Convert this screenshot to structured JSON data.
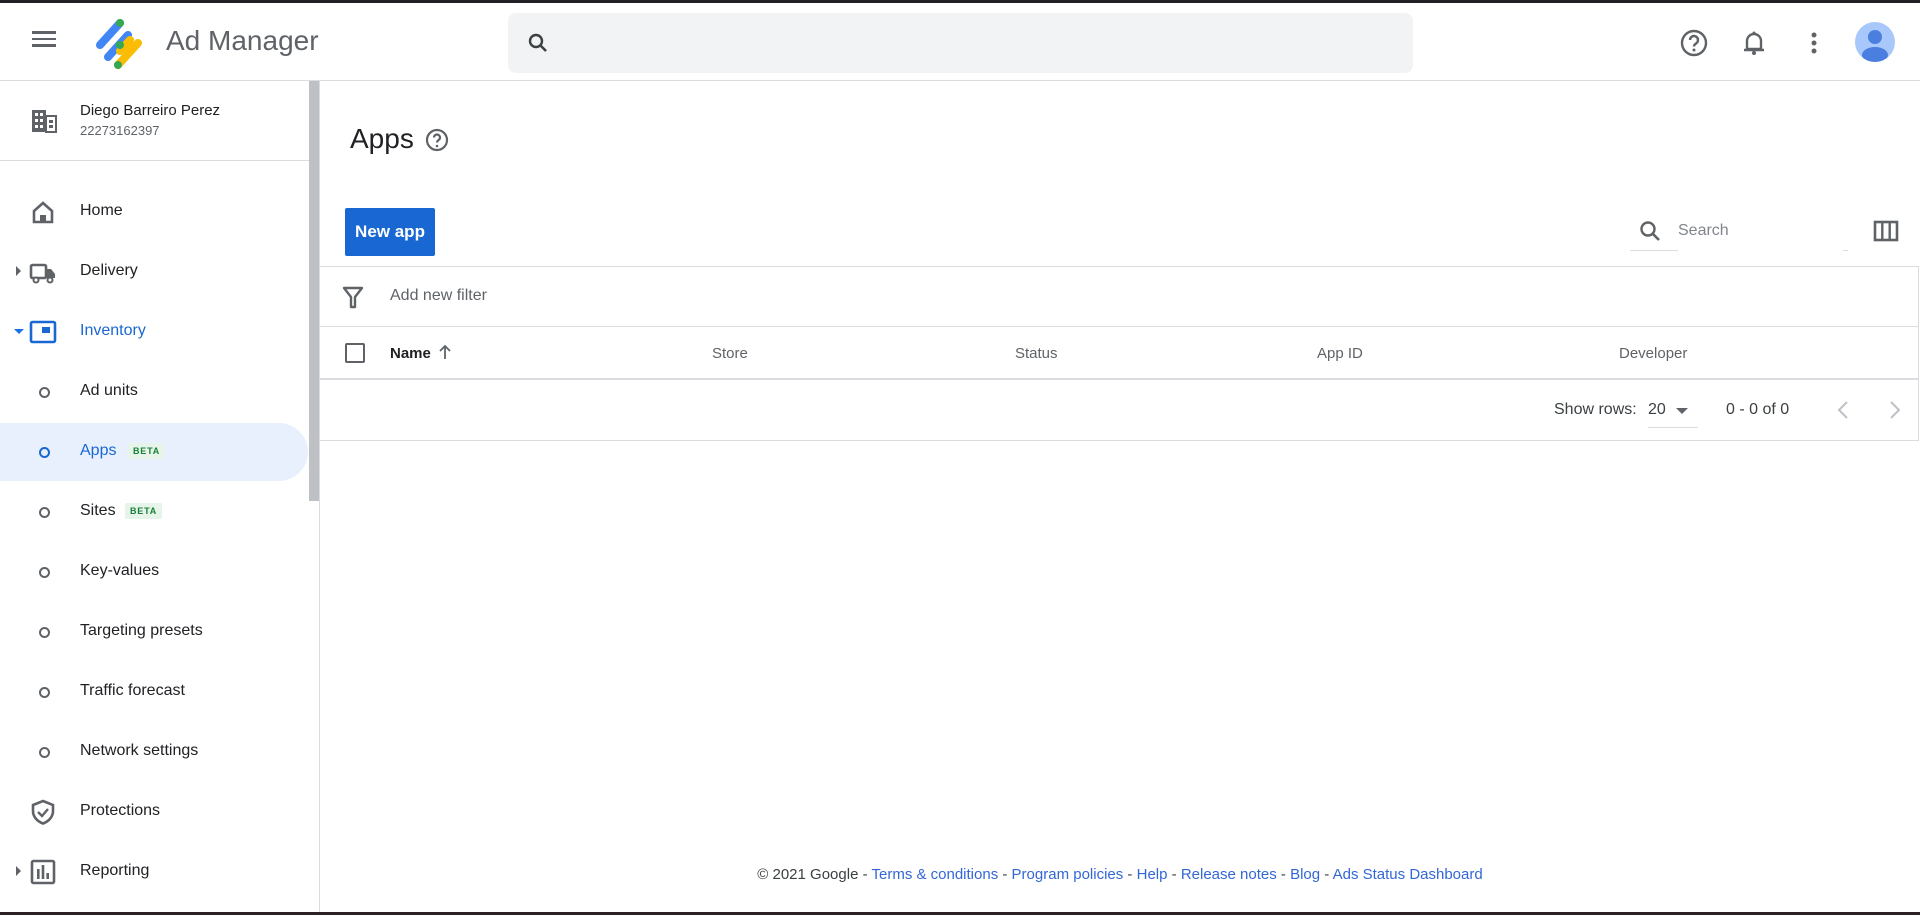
{
  "header": {
    "app_name": "Ad Manager",
    "search_placeholder": "",
    "icons": [
      "menu-icon",
      "search-icon",
      "help-icon",
      "notifications-icon",
      "more-vert-icon",
      "account-avatar"
    ]
  },
  "account": {
    "name": "Diego Barreiro Perez",
    "id": "22273162397"
  },
  "sidebar": {
    "items": [
      {
        "label": "Home",
        "icon": "home-icon"
      },
      {
        "label": "Delivery",
        "icon": "truck-icon",
        "expandable": true
      },
      {
        "label": "Inventory",
        "icon": "inventory-icon",
        "expanded": true
      },
      {
        "label": "Ad units",
        "sub": true
      },
      {
        "label": "Apps",
        "sub": true,
        "badge": "BETA",
        "active": true
      },
      {
        "label": "Sites",
        "sub": true,
        "badge": "BETA"
      },
      {
        "label": "Key-values",
        "sub": true
      },
      {
        "label": "Targeting presets",
        "sub": true
      },
      {
        "label": "Traffic forecast",
        "sub": true
      },
      {
        "label": "Network settings",
        "sub": true
      },
      {
        "label": "Protections",
        "icon": "shield-check-icon"
      },
      {
        "label": "Reporting",
        "icon": "bar-chart-icon",
        "expandable": true
      }
    ]
  },
  "main": {
    "title": "Apps",
    "new_app_label": "New app",
    "search_placeholder": "Search",
    "filter_label": "Add new filter",
    "columns": [
      "Name",
      "Store",
      "Status",
      "App ID",
      "Developer"
    ],
    "sort": {
      "column": "Name",
      "direction": "ascending"
    },
    "rows": [],
    "pagination": {
      "show_rows_label": "Show rows:",
      "rows_per_page": "20",
      "range": "0 - 0 of 0"
    }
  },
  "footer": {
    "copyright": "© 2021 Google",
    "links": [
      "Terms & conditions",
      "Program policies",
      "Help",
      "Release notes",
      "Blog",
      "Ads Status Dashboard"
    ]
  },
  "colors": {
    "accent": "#1967d2",
    "active_bg": "#e8f0fe",
    "beta_text": "#188038",
    "beta_bg": "#e6f4ea",
    "link": "#3367d6"
  }
}
